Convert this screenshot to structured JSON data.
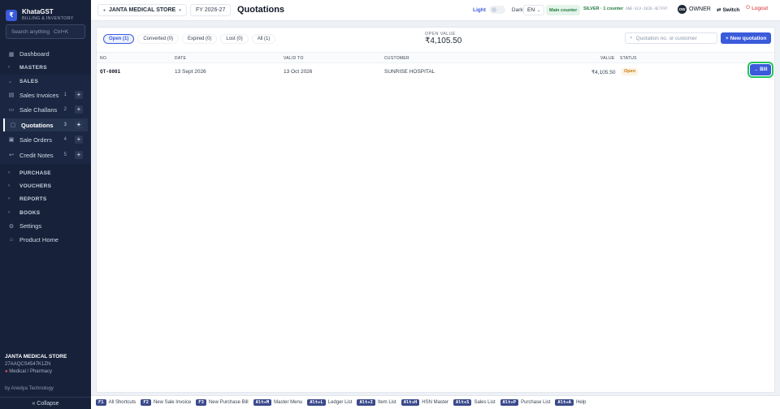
{
  "brand": {
    "logo": "₹",
    "title": "KhataGST",
    "subtitle": "BILLING & INVENTORY"
  },
  "sidebar": {
    "search_placeholder": "Search anything",
    "search_shortcut": "Ctrl+K",
    "dashboard": "Dashboard",
    "masters": "MASTERS",
    "sales": "SALES",
    "sales_items": [
      {
        "label": "Sales Invoices",
        "count": "1"
      },
      {
        "label": "Sale Challans",
        "count": "2"
      },
      {
        "label": "Quotations",
        "count": "3"
      },
      {
        "label": "Sale Orders",
        "count": "4"
      },
      {
        "label": "Credit Notes",
        "count": "5"
      }
    ],
    "groups": [
      "PURCHASE",
      "VOUCHERS",
      "REPORTS",
      "BOOKS"
    ],
    "settings": "Settings",
    "product_home": "Product Home",
    "store_name": "JANTA MEDICAL STORE",
    "store_gst": "27AAQCS4547K1ZN",
    "store_type": "Medical / Pharmacy",
    "vendor": "by Anedya Technology",
    "collapse": "« Collapse"
  },
  "topbar": {
    "store": "JANTA MEDICAL STORE",
    "fy": "FY 2026-27",
    "title": "Quotations",
    "light": "Light",
    "dark": "Dark",
    "lang": "EN",
    "counter": "Main counter",
    "tier": "SILVER · 1 counter",
    "license_id": "ANE-SLV-2026-4E7F97",
    "avatar": "OW",
    "owner": "OWNER",
    "switch": "Switch",
    "logout": "Logout"
  },
  "filters": [
    {
      "label": "Open (1)",
      "active": true
    },
    {
      "label": "Converted (0)",
      "active": false
    },
    {
      "label": "Expired (0)",
      "active": false
    },
    {
      "label": "Lost (0)",
      "active": false
    },
    {
      "label": "All (1)",
      "active": false
    }
  ],
  "open_value": {
    "label": "OPEN VALUE",
    "amount": "₹4,105.50"
  },
  "search_placeholder": "Quotation no. or customer",
  "new_button": "+ New quotation",
  "table": {
    "headers": {
      "no": "NO.",
      "date": "DATE",
      "valid_to": "VALID TO",
      "customer": "CUSTOMER",
      "value": "VALUE",
      "status": "STATUS"
    },
    "rows": [
      {
        "no": "QT-0001",
        "date": "13 Sept 2026",
        "valid_to": "13 Oct 2026",
        "customer": "SUNRISE HOSPITAL",
        "value": "₹4,105.50",
        "status": "Open",
        "action": "→ Bill"
      }
    ]
  },
  "shortcuts": [
    {
      "key": "F1",
      "label": "All Shortcuts"
    },
    {
      "key": "F2",
      "label": "New Sale Invoice"
    },
    {
      "key": "F3",
      "label": "New Purchase Bill"
    },
    {
      "key": "Alt+M",
      "label": "Master Menu"
    },
    {
      "key": "Alt+L",
      "label": "Ledger List"
    },
    {
      "key": "Alt+I",
      "label": "Item List"
    },
    {
      "key": "Alt+H",
      "label": "HSN Master"
    },
    {
      "key": "Alt+S",
      "label": "Sales List"
    },
    {
      "key": "Alt+P",
      "label": "Purchase List"
    },
    {
      "key": "Alt+A",
      "label": "Help"
    }
  ],
  "colors": {
    "sidebar": "#17213a",
    "accent": "#3b5bdb",
    "status_open": "#c47a10",
    "focus": "#22c55e"
  }
}
